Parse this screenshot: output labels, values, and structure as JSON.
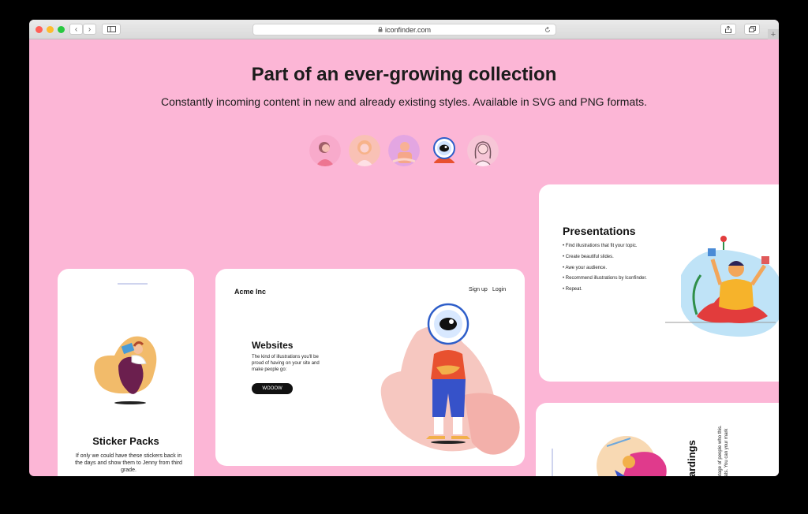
{
  "browser": {
    "url": "iconfinder.com",
    "back_icon": "chevron-left-icon",
    "forward_icon": "chevron-right-icon",
    "new_tab_label": "+"
  },
  "colors": {
    "page_bg": "#fcb6d6",
    "close": "#ff5f57",
    "minimize": "#febc2e",
    "zoom": "#28c840"
  },
  "hero": {
    "title": "Part of an ever-growing collection",
    "subtitle": "Constantly incoming content in new and already existing styles. Available in SVG and PNG formats."
  },
  "style_avatars": [
    "woman-avatar",
    "blonde-avatar",
    "purple-avatar",
    "astronaut-eye-avatar",
    "sketch-woman-avatar"
  ],
  "cards": {
    "sticker": {
      "title": "Sticker Packs",
      "text": "If only we could have these stickers back in the days and show them to Jenny from third grade."
    },
    "websites": {
      "brand": "Acme Inc",
      "nav_signup": "Sign up",
      "nav_login": "Login",
      "title": "Websites",
      "text": "The kind of illustrations you'll be proud of having on your site and make people go:",
      "button": "WOOOW"
    },
    "presentations": {
      "title": "Presentations",
      "items": [
        "Find illustrations that fit your topic.",
        "Create beautiful slides.",
        "Awe your audience.",
        "Recommend illustrations by Iconfinder.",
        "Repeat."
      ]
    },
    "onboardings": {
      "title": "boardings",
      "text": "percentage of people who this. Congrats. You can your mark now."
    }
  }
}
